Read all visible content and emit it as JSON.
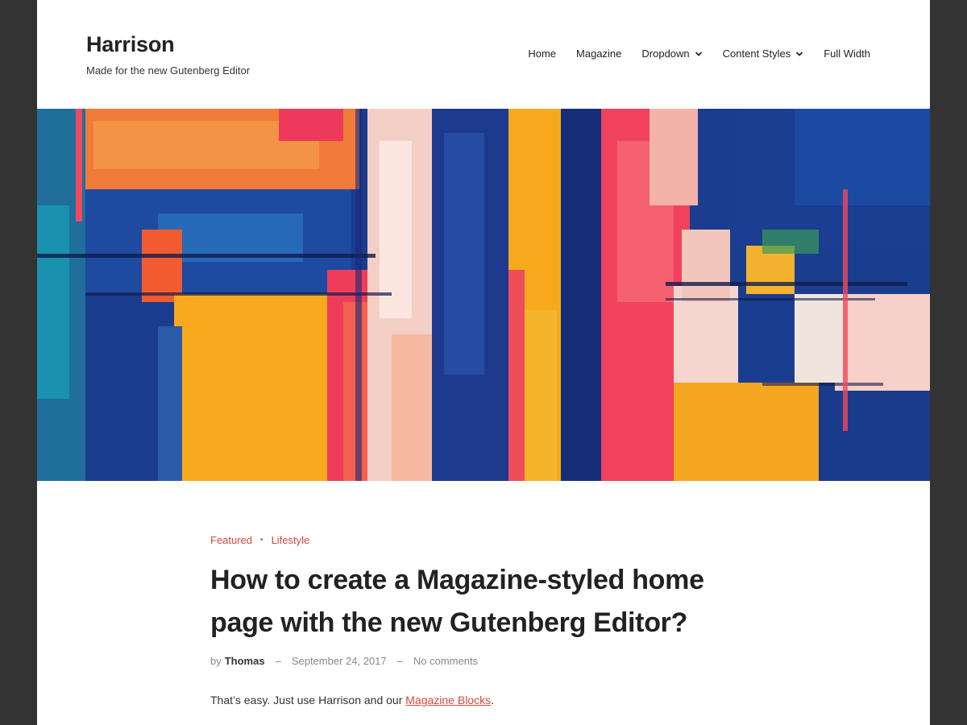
{
  "site": {
    "title": "Harrison",
    "description": "Made for the new Gutenberg Editor"
  },
  "nav": {
    "items": [
      {
        "label": "Home",
        "has_dropdown": false
      },
      {
        "label": "Magazine",
        "has_dropdown": false
      },
      {
        "label": "Dropdown",
        "has_dropdown": true
      },
      {
        "label": "Content Styles",
        "has_dropdown": true
      },
      {
        "label": "Full Width",
        "has_dropdown": false
      }
    ]
  },
  "hero": {
    "icon": "abstract-painting-image",
    "colors": [
      "#1a3a8c",
      "#f5a623",
      "#f0465a",
      "#f7d9d0",
      "#1c7fa0"
    ]
  },
  "post": {
    "categories": [
      "Featured",
      "Lifestyle"
    ],
    "category_separator": "•",
    "title": "How to create a Magazine-styled home page with the new Gutenberg Editor?",
    "by_label": "by",
    "author": "Thomas",
    "meta_separator": "–",
    "date": "September 24, 2017",
    "comments": "No comments",
    "excerpt_prefix": "That’s easy. Just use Harrison and our ",
    "excerpt_link": "Magazine Blocks",
    "excerpt_suffix": "."
  },
  "colors": {
    "accent": "#d9473a",
    "backdrop": "#333333"
  }
}
